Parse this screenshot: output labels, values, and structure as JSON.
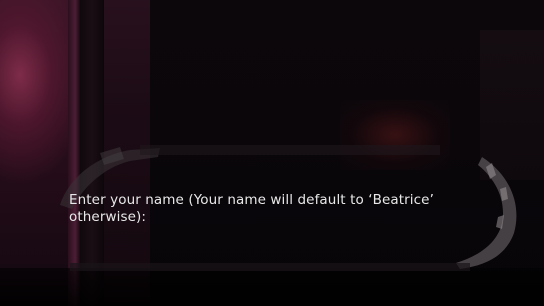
{
  "dialogue": {
    "prompt": "Enter your name (Your name will default to ‘Beatrice’ otherwise):"
  },
  "colors": {
    "text": "#e9e9e9",
    "background": "#070407",
    "accent_glow": "#82304b"
  },
  "icons": {
    "frame": "torn-paper-frame"
  }
}
